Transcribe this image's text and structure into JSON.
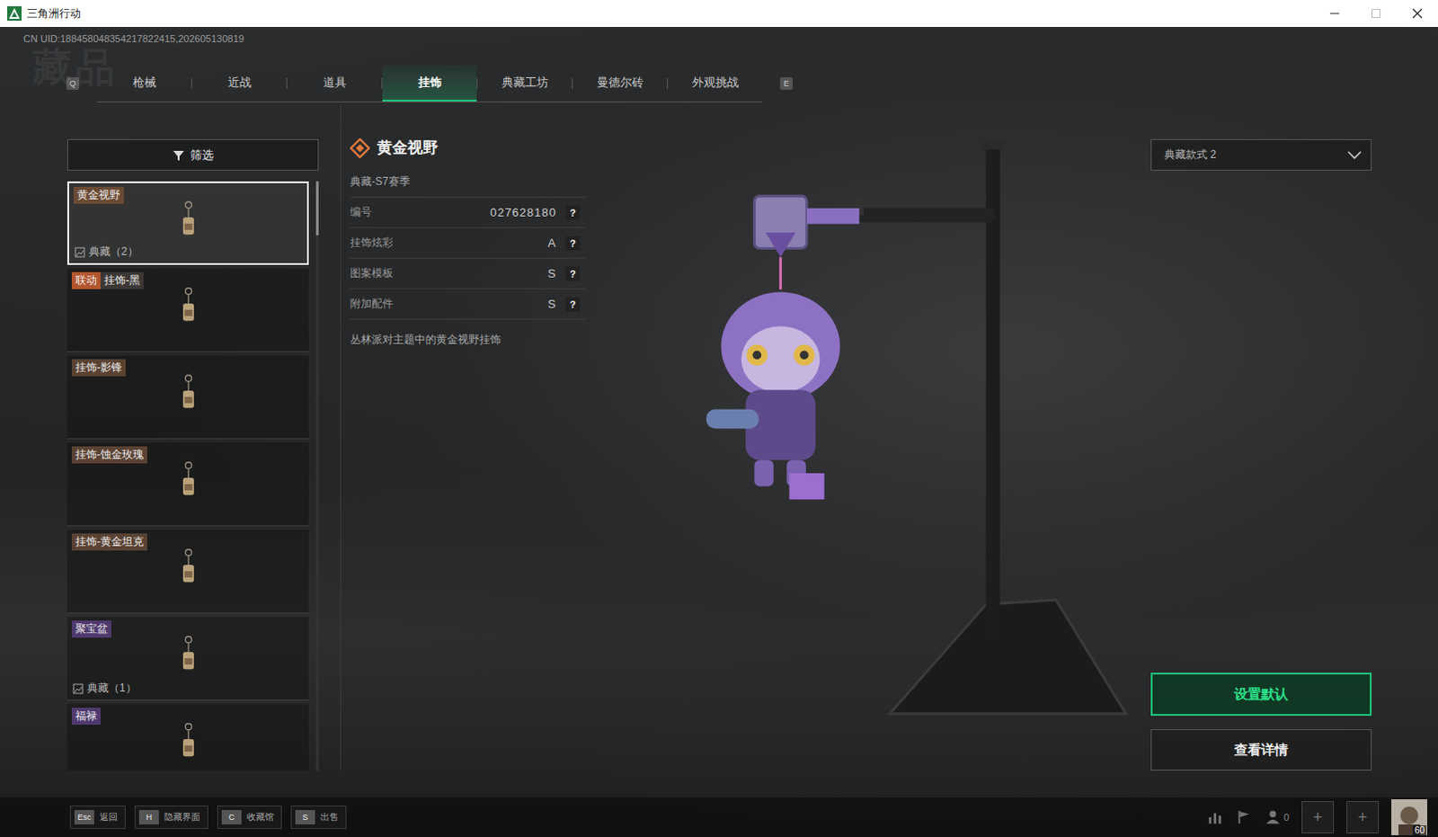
{
  "window": {
    "title": "三角洲行动"
  },
  "uid": "CN UID:188458048354217822415,202605130819",
  "watermark": "藏品",
  "tabs": {
    "prev_key": "Q",
    "next_key": "E",
    "items": [
      {
        "label": "枪械",
        "selected": false
      },
      {
        "label": "近战",
        "selected": false
      },
      {
        "label": "道具",
        "selected": false
      },
      {
        "label": "挂饰",
        "selected": true
      },
      {
        "label": "典藏工坊",
        "selected": false
      },
      {
        "label": "曼德尔砖",
        "selected": false
      },
      {
        "label": "外观挑战",
        "selected": false
      }
    ]
  },
  "filter": {
    "label": "筛选"
  },
  "items": [
    {
      "tags": [
        {
          "text": "黄金视野",
          "color": "#6a4a34"
        }
      ],
      "collection": "典藏（2）",
      "selected": true
    },
    {
      "tags": [
        {
          "text": "联动",
          "color": "#b3552e"
        },
        {
          "text": "挂饰-黑",
          "color": "#3b3734"
        }
      ],
      "selected": false
    },
    {
      "tags": [
        {
          "text": "挂饰-影锋",
          "color": "#5a4232"
        }
      ],
      "selected": false
    },
    {
      "tags": [
        {
          "text": "挂饰-蚀金玫瑰",
          "color": "#5a4232"
        }
      ],
      "selected": false
    },
    {
      "tags": [
        {
          "text": "挂饰-黄金坦克",
          "color": "#5a4232"
        }
      ],
      "selected": false
    },
    {
      "tags": [
        {
          "text": "聚宝盆",
          "color": "#4f3a6e"
        }
      ],
      "collection": "典藏（1）",
      "selected": false
    },
    {
      "tags": [
        {
          "text": "福禄",
          "color": "#4f3a6e"
        }
      ],
      "selected": false
    }
  ],
  "detail": {
    "name": "黄金视野",
    "series": "典藏-S7赛季",
    "attributes": [
      {
        "label": "编号",
        "value": "027628180",
        "help": "?"
      },
      {
        "label": "挂饰炫彩",
        "value": "A",
        "help": "?"
      },
      {
        "label": "图案模板",
        "value": "S",
        "help": "?"
      },
      {
        "label": "附加配件",
        "value": "S",
        "help": "?"
      }
    ],
    "description": "丛林派对主题中的黄金视野挂饰"
  },
  "style_select": {
    "value": "典藏款式 2"
  },
  "actions": [
    {
      "label": "设置默认",
      "primary": true
    },
    {
      "label": "查看详情",
      "primary": false
    }
  ],
  "hotkeys": [
    {
      "key": "Esc",
      "label": "返回"
    },
    {
      "key": "H",
      "label": "隐藏界面"
    },
    {
      "key": "C",
      "label": "收藏馆"
    },
    {
      "key": "S",
      "label": "出售"
    }
  ],
  "status": {
    "friends": "0",
    "slots": [
      "+",
      "+"
    ],
    "level": "60"
  }
}
